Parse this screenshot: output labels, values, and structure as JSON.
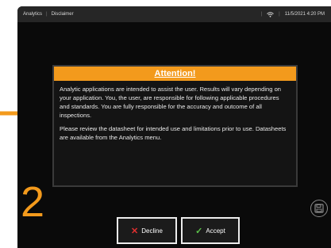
{
  "statusbar": {
    "app": "Analytics",
    "page": "Disclaimer",
    "datetime": "11/5/2021 4:20 PM"
  },
  "dialog": {
    "title": "Attention!",
    "paragraph1": "Analytic applications are intended to assist the user. Results will vary depending on your application. You, the user, are responsible for following applicable procedures and standards. You are fully responsible for the accuracy and outcome of all inspections.",
    "paragraph2": "Please review the datasheet for intended use and limitations prior to use. Datasheets are available from the Analytics menu."
  },
  "step_number": "2",
  "buttons": {
    "decline": "Decline",
    "accept": "Accept"
  },
  "icons": {
    "wifi": "wifi-icon",
    "save": "save-icon",
    "arrow": "arrow-right-icon"
  },
  "colors": {
    "accent": "#f39a1c",
    "decline": "#e03030",
    "accept": "#5cc24a"
  }
}
